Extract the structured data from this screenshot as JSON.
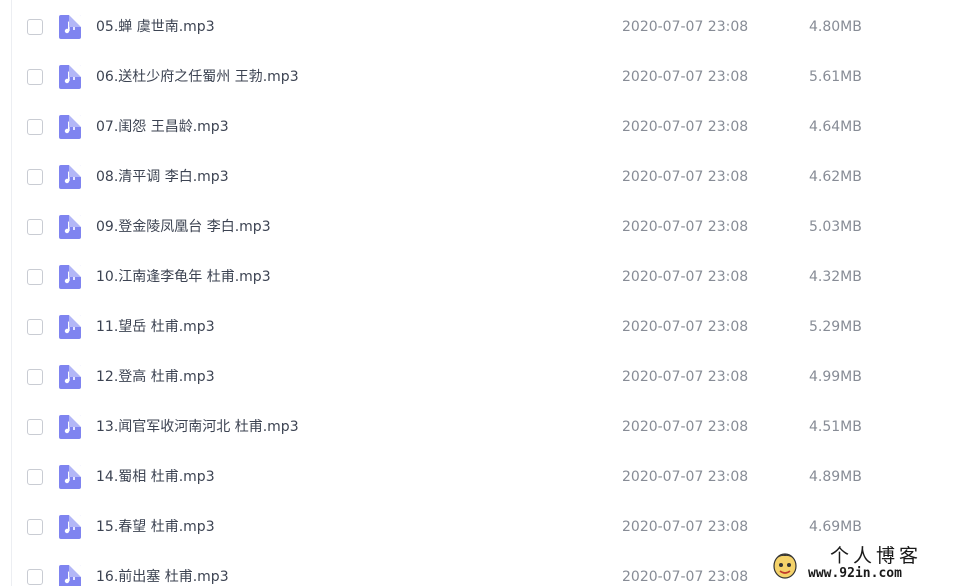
{
  "files": [
    {
      "name": "05.蝉 虞世南.mp3",
      "date": "2020-07-07 23:08",
      "size": "4.80MB"
    },
    {
      "name": "06.送杜少府之任蜀州 王勃.mp3",
      "date": "2020-07-07 23:08",
      "size": "5.61MB"
    },
    {
      "name": "07.闺怨 王昌龄.mp3",
      "date": "2020-07-07 23:08",
      "size": "4.64MB"
    },
    {
      "name": "08.清平调 李白.mp3",
      "date": "2020-07-07 23:08",
      "size": "4.62MB"
    },
    {
      "name": "09.登金陵凤凰台 李白.mp3",
      "date": "2020-07-07 23:08",
      "size": "5.03MB"
    },
    {
      "name": "10.江南逢李龟年 杜甫.mp3",
      "date": "2020-07-07 23:08",
      "size": "4.32MB"
    },
    {
      "name": "11.望岳 杜甫.mp3",
      "date": "2020-07-07 23:08",
      "size": "5.29MB"
    },
    {
      "name": "12.登高 杜甫.mp3",
      "date": "2020-07-07 23:08",
      "size": "4.99MB"
    },
    {
      "name": "13.闻官军收河南河北 杜甫.mp3",
      "date": "2020-07-07 23:08",
      "size": "4.51MB"
    },
    {
      "name": "14.蜀相 杜甫.mp3",
      "date": "2020-07-07 23:08",
      "size": "4.89MB"
    },
    {
      "name": "15.春望 杜甫.mp3",
      "date": "2020-07-07 23:08",
      "size": "4.69MB"
    },
    {
      "name": "16.前出塞 杜甫.mp3",
      "date": "2020-07-07 23:08",
      "size": ""
    }
  ],
  "file_icon": "music-file-icon",
  "colors": {
    "icon": "#7f84f0",
    "name_text": "#3c4352",
    "meta_text": "#878c96"
  },
  "watermark": {
    "title": "个人博客",
    "url": "www.92in.com"
  }
}
